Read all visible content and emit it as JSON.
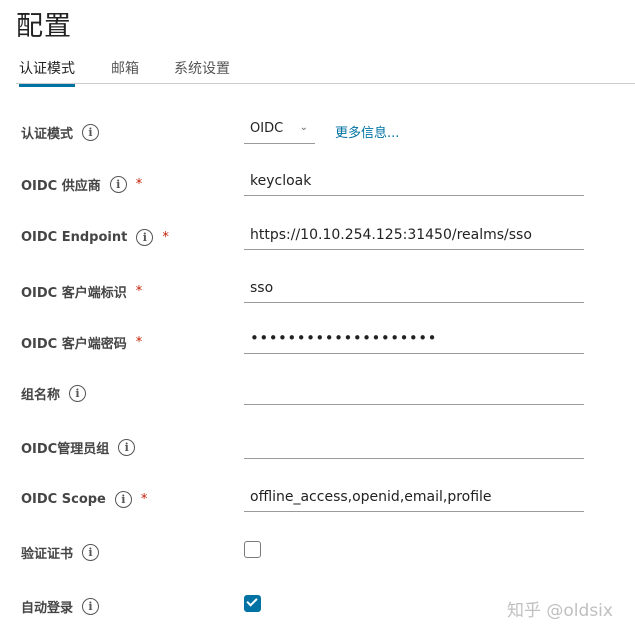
{
  "page": {
    "title": "配置"
  },
  "tabs": [
    {
      "label": "认证模式",
      "active": true
    },
    {
      "label": "邮箱",
      "active": false
    },
    {
      "label": "系统设置",
      "active": false
    }
  ],
  "form": {
    "auth_mode": {
      "label": "认证模式",
      "value": "OIDC",
      "more_link": "更多信息..."
    },
    "provider": {
      "label": "OIDC 供应商",
      "required_mark": "*",
      "value": "keycloak"
    },
    "endpoint": {
      "label": "OIDC Endpoint",
      "required_mark": "*",
      "value": "https://10.10.254.125:31450/realms/sso"
    },
    "client_id": {
      "label": "OIDC 客户端标识",
      "required_mark": "*",
      "value": "sso"
    },
    "client_secret": {
      "label": "OIDC 客户端密码",
      "required_mark": "*",
      "value": "••••••••••••••••••••"
    },
    "group_name": {
      "label": "组名称",
      "value": ""
    },
    "admin_group": {
      "label": "OIDC管理员组",
      "value": ""
    },
    "scope": {
      "label": "OIDC Scope",
      "required_mark": "*",
      "value": "offline_access,openid,email,profile"
    },
    "verify_cert": {
      "label": "验证证书",
      "checked": false
    },
    "auto_login": {
      "label": "自动登录",
      "checked": true
    }
  },
  "info_icon_glyph": "i",
  "watermark": "知乎 @oldsix",
  "colors": {
    "accent": "#0072a3",
    "required": "#c21d00"
  }
}
